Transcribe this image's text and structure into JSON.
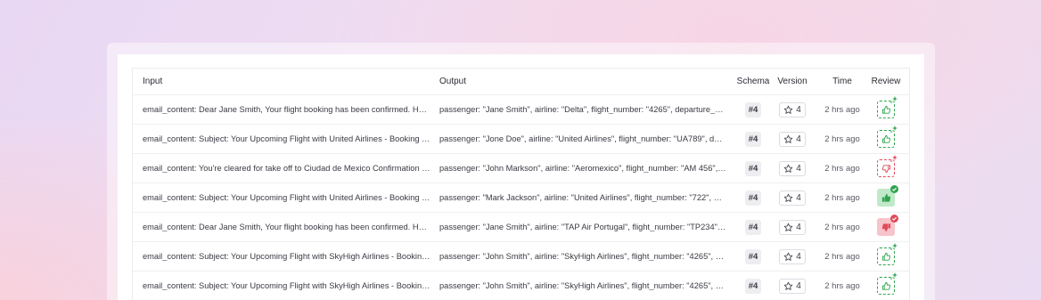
{
  "table": {
    "headers": {
      "input": "Input",
      "output": "Output",
      "schema": "Schema",
      "version": "Version",
      "time": "Time",
      "review": "Review"
    },
    "rows": [
      {
        "input": "email_content: Dear Jane Smith, Your flight booking has been confirmed. Here a...",
        "output": "passenger: \"Jane Smith\", airline: \"Delta\", flight_number: \"4265\", departure_airpor...",
        "schema": "#4",
        "version": "4",
        "time": "2 hrs ago",
        "review": "pending-good"
      },
      {
        "input": "email_content: Subject: Your Upcoming Flight with United Airlines - Booking Co...",
        "output": "passenger: \"Jone Doe\", airline: \"United Airlines\", flight_number: \"UA789\", depart...",
        "schema": "#4",
        "version": "4",
        "time": "2 hrs ago",
        "review": "pending-good"
      },
      {
        "input": "email_content: You're cleared for take off to Ciudad de Mexico Confirmation #J...",
        "output": "passenger: \"John Markson\", airline: \"Aeromexico\", flight_number: \"AM 456\", dep...",
        "schema": "#4",
        "version": "4",
        "time": "2 hrs ago",
        "review": "pending-bad"
      },
      {
        "input": "email_content: Subject: Your Upcoming Flight with United Airlines - Booking Co...",
        "output": "passenger: \"Mark Jackson\", airline: \"United Airlines\", flight_number: \"722\", depar...",
        "schema": "#4",
        "version": "4",
        "time": "2 hrs ago",
        "review": "confirmed-good"
      },
      {
        "input": "email_content: Dear Jane Smith, Your flight booking has been confirmed. Here a...",
        "output": "passenger: \"Jane Smith\", airline: \"TAP Air Portugal\", flight_number: \"TP234\", dep...",
        "schema": "#4",
        "version": "4",
        "time": "2 hrs ago",
        "review": "confirmed-bad"
      },
      {
        "input": "email_content: Subject: Your Upcoming Flight with SkyHigh Airlines - Booking R...",
        "output": "passenger: \"John Smith\", airline: \"SkyHigh Airlines\", flight_number: \"4265\", depar...",
        "schema": "#4",
        "version": "4",
        "time": "2 hrs ago",
        "review": "pending-good"
      },
      {
        "input": "email_content: Subject: Your Upcoming Flight with SkyHigh Airlines - Booking R...",
        "output": "passenger: \"John Smith\", airline: \"SkyHigh Airlines\", flight_number: \"4265\", depar...",
        "schema": "#4",
        "version": "4",
        "time": "2 hrs ago",
        "review": "pending-good"
      }
    ]
  },
  "colors": {
    "good": "#2fa34e",
    "bad": "#e04a5a",
    "good_bg": "#bfe9c8",
    "bad_bg": "#f8c4cb"
  },
  "icons": {
    "version": "star-icon",
    "review_good": "thumbs-up-icon",
    "review_bad": "thumbs-down-icon",
    "pending": "sparkle-icon",
    "confirmed": "check-icon"
  }
}
